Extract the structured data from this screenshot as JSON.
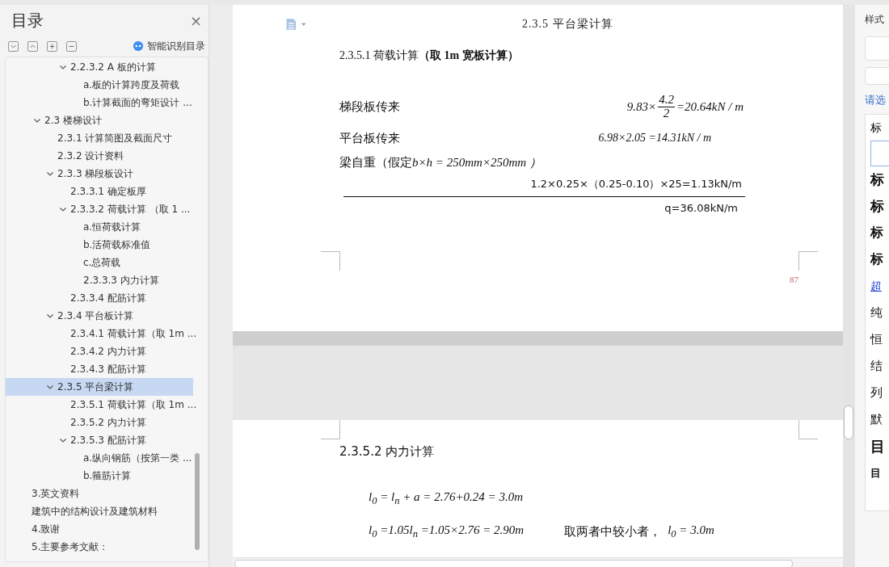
{
  "toc": {
    "title": "目录",
    "close": "×",
    "smart_label": "智能识别目录",
    "items": [
      {
        "label": "2.2.3.2 A 板的计算",
        "kind": "subsubsection",
        "selected": false,
        "expanded": true,
        "children": [
          {
            "label": "a.板的计算跨度及荷载",
            "selected": false
          },
          {
            "label": "b.计算截面的弯矩设计 ...",
            "selected": false
          }
        ]
      },
      {
        "label": "2.3  楼梯设计",
        "kind": "section",
        "selected": false,
        "expanded": true,
        "children": [
          {
            "label": "2.3.1  计算简图及截面尺寸",
            "selected": false
          },
          {
            "label": "2.3.2  设计资料",
            "selected": false
          },
          {
            "label": "2.3.3  梯段板设计",
            "selected": false,
            "expanded": true,
            "children": [
              {
                "label": "2.3.3.1  确定板厚",
                "selected": false
              },
              {
                "label": "2.3.3.2  荷载计算 （取 1 ...",
                "selected": false,
                "expanded": true,
                "children": [
                  {
                    "label": "a.恒荷载计算",
                    "selected": false
                  },
                  {
                    "label": "b.活荷载标准值",
                    "selected": false
                  },
                  {
                    "label": "c.总荷载",
                    "selected": false
                  },
                  {
                    "label": "2.3.3.3  内力计算",
                    "selected": false
                  }
                ]
              },
              {
                "label": "2.3.3.4  配筋计算",
                "selected": false
              }
            ]
          },
          {
            "label": "2.3.4  平台板计算",
            "selected": false,
            "expanded": true,
            "children": [
              {
                "label": "2.3.4.1  荷载计算（取 1m ...",
                "selected": false
              },
              {
                "label": "2.3.4.2  内力计算",
                "selected": false
              },
              {
                "label": "2.3.4.3  配筋计算",
                "selected": false
              }
            ]
          },
          {
            "label": "2.3.5  平台梁计算",
            "selected": true,
            "expanded": true,
            "children": [
              {
                "label": "2.3.5.1  荷载计算（取 1m ...",
                "selected": false
              },
              {
                "label": "2.3.5.2  内力计算",
                "selected": false
              },
              {
                "label": "2.3.5.3  配筋计算",
                "selected": false,
                "expanded": true,
                "children": [
                  {
                    "label": "a.纵向钢筋（按第一类 ...",
                    "selected": false
                  },
                  {
                    "label": "b.箍筋计算",
                    "selected": false
                  }
                ]
              }
            ]
          }
        ]
      },
      {
        "label": "3.英文资料",
        "kind": "chapter",
        "selected": false
      },
      {
        "label": "建筑中的结构设计及建筑材料",
        "kind": "chapter",
        "selected": false
      },
      {
        "label": "4.致谢",
        "kind": "chapter",
        "selected": false
      },
      {
        "label": "5.主要参考文献：",
        "kind": "chapter",
        "selected": false
      }
    ]
  },
  "page1": {
    "header": "2.3.5  平台梁计算",
    "heading": "2.3.5.1  荷载计算**（取 1m 宽板计算）**",
    "loads": [
      {
        "label": "梯段板传来",
        "kind": "fraction",
        "before": "9.83×",
        "numerator": "4.2",
        "denominator": "2",
        "after": "=20.64kN / m"
      },
      {
        "label": "平台板传来",
        "kind": "plain",
        "formula": "6.98×2.05 =14.31kN / m"
      },
      {
        "label": "梁自重（假定",
        "kind": "inline",
        "formula": "b×h = 250mm×250mm ）"
      }
    ],
    "self_weight": "1.2×0.25×（0.25-0.10）×25=1.13kN/m",
    "total": "q=36.08kN/m",
    "page_number": "87"
  },
  "page2": {
    "heading": "2.3.5.2  内力计算",
    "formula_1": "l$_{0}$ = l$_{n}$ + a = 2.76+0.24 = 3.0m",
    "formula_2": "l$_{0}$ =1.05l$_{n}$ =1.05×2.76 = 2.90m",
    "note": "取两者中较小者，",
    "formula_3": "l$_{0}$ = 3.0m"
  },
  "style_panel": {
    "title": "样式",
    "hint": "请选",
    "current": "标",
    "styles": [
      "标",
      "标",
      "标",
      "标",
      "超",
      "纯",
      "恒",
      "结",
      "列",
      "默",
      "目",
      "目"
    ]
  }
}
